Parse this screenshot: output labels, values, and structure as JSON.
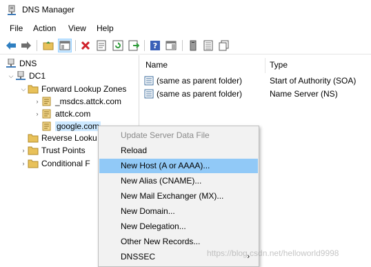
{
  "window": {
    "title": "DNS Manager",
    "app_icon": "dns-server-icon"
  },
  "menu": [
    "File",
    "Action",
    "View",
    "Help"
  ],
  "toolbar": {
    "icons": [
      "back-arrow-icon",
      "forward-arrow-icon",
      "up-folder-icon",
      "show-hide-console-tree-icon",
      "delete-icon",
      "properties-icon",
      "refresh-icon",
      "export-list-icon",
      "help-icon",
      "action-pane-icon",
      "server-icon",
      "list-icon",
      "copy-icon"
    ]
  },
  "tree": {
    "root": "DNS",
    "server": "DC1",
    "forward_zones": "Forward Lookup Zones",
    "zone_msdcs": "_msdcs.attck.com",
    "zone_attck": "attck.com",
    "zone_google": "google.com",
    "reverse_zones": "Reverse Looku",
    "trust_points": "Trust Points",
    "conditional": "Conditional F"
  },
  "list": {
    "col_name": "Name",
    "col_type": "Type",
    "rows": [
      {
        "name": "(same as parent folder)",
        "type": "Start of Authority (SOA)"
      },
      {
        "name": "(same as parent folder)",
        "type": "Name Server (NS)"
      }
    ]
  },
  "context_menu": {
    "items": [
      {
        "label": "Update Server Data File",
        "state": "disabled"
      },
      {
        "label": "Reload",
        "state": "normal"
      },
      {
        "label": "New Host (A or AAAA)...",
        "state": "hover"
      },
      {
        "label": "New Alias (CNAME)...",
        "state": "normal"
      },
      {
        "label": "New Mail Exchanger (MX)...",
        "state": "normal"
      },
      {
        "label": "New Domain...",
        "state": "normal"
      },
      {
        "label": "New Delegation...",
        "state": "normal"
      },
      {
        "label": "Other New Records...",
        "state": "normal"
      },
      {
        "label": "DNSSEC",
        "state": "submenu",
        "arrow": "›"
      }
    ]
  },
  "watermark": "https://blog.csdn.net/helloworld9998",
  "colors": {
    "selection": "#cce8ff",
    "menu_hover": "#91c9f7",
    "folder": "#e8c15a"
  }
}
